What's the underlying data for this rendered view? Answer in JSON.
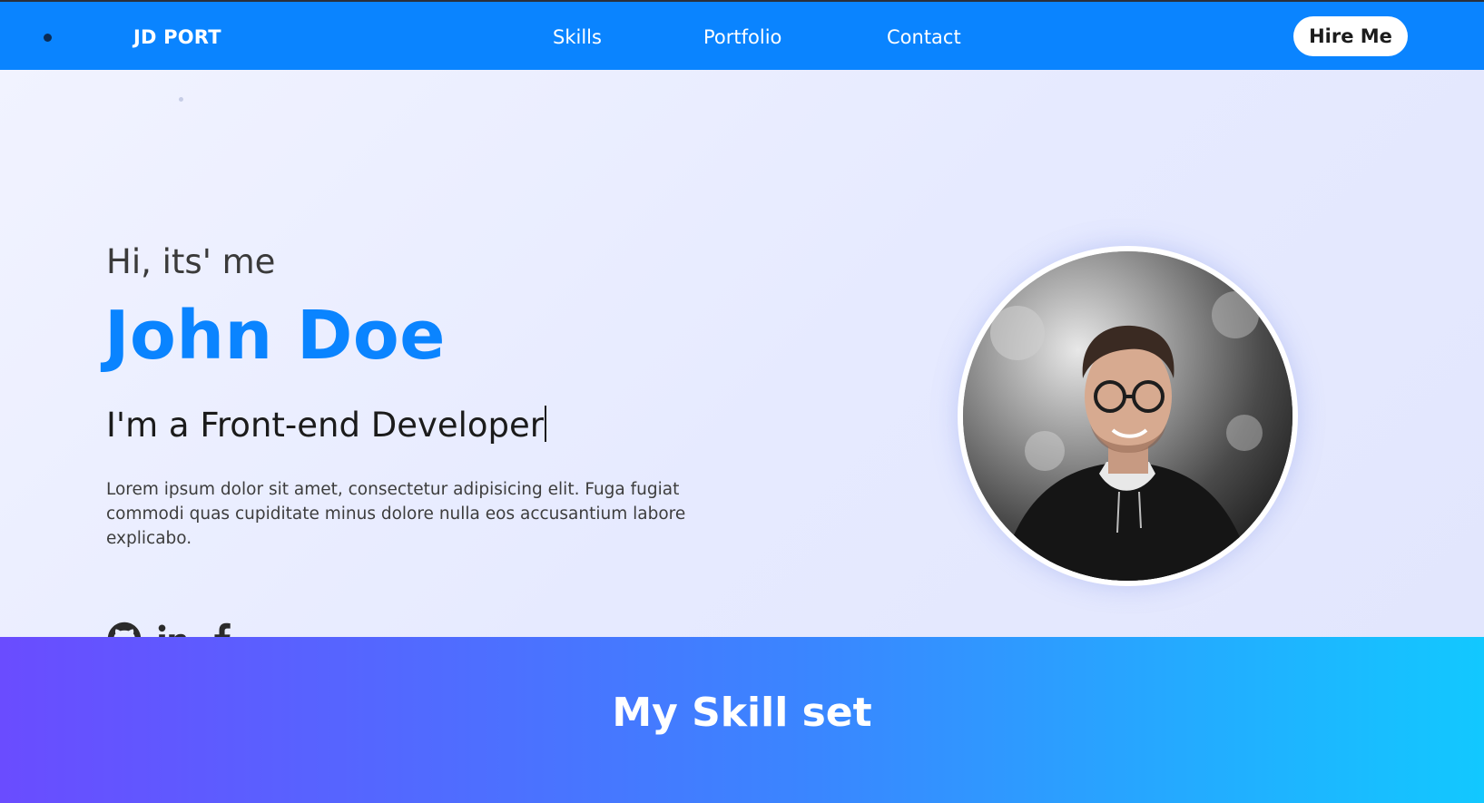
{
  "nav": {
    "brand": "JD PORT",
    "links": [
      "Skills",
      "Portfolio",
      "Contact"
    ],
    "cta": "Hire Me"
  },
  "hero": {
    "greeting": "Hi, its' me",
    "name": "John Doe",
    "role": "I'm a Front-end Developer",
    "bio": "Lorem ipsum dolor sit amet, consectetur adipisicing elit. Fuga fugiat commodi quas cupiditate minus dolore nulla eos accusantium labore explicabo.",
    "socials": [
      "github-icon",
      "linkedin-icon",
      "facebook-icon"
    ]
  },
  "skills": {
    "title": "My Skill set"
  },
  "colors": {
    "primary": "#0a84ff",
    "skills_gradient_start": "#6a4cff",
    "skills_gradient_end": "#12c8ff"
  }
}
